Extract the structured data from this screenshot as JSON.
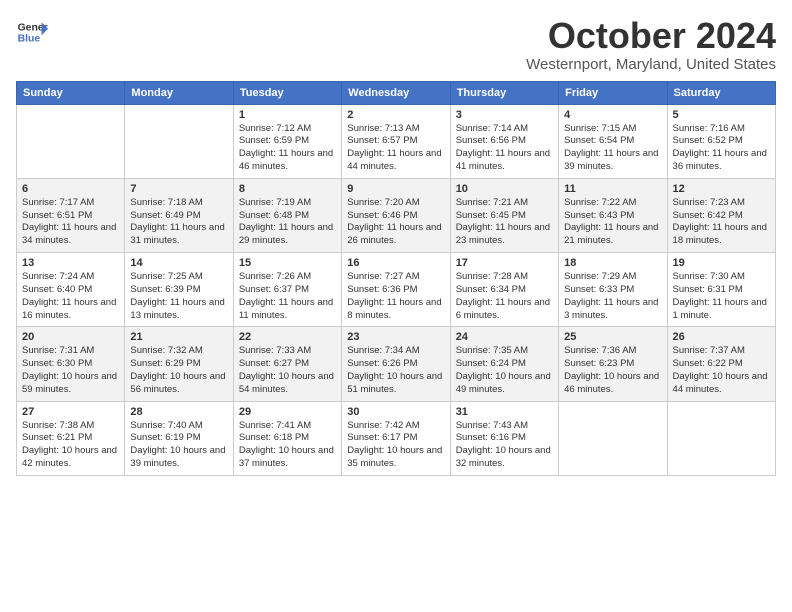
{
  "header": {
    "logo_line1": "General",
    "logo_line2": "Blue",
    "month": "October 2024",
    "location": "Westernport, Maryland, United States"
  },
  "days_of_week": [
    "Sunday",
    "Monday",
    "Tuesday",
    "Wednesday",
    "Thursday",
    "Friday",
    "Saturday"
  ],
  "weeks": [
    [
      {
        "day": "",
        "info": ""
      },
      {
        "day": "",
        "info": ""
      },
      {
        "day": "1",
        "info": "Sunrise: 7:12 AM\nSunset: 6:59 PM\nDaylight: 11 hours and 46 minutes."
      },
      {
        "day": "2",
        "info": "Sunrise: 7:13 AM\nSunset: 6:57 PM\nDaylight: 11 hours and 44 minutes."
      },
      {
        "day": "3",
        "info": "Sunrise: 7:14 AM\nSunset: 6:56 PM\nDaylight: 11 hours and 41 minutes."
      },
      {
        "day": "4",
        "info": "Sunrise: 7:15 AM\nSunset: 6:54 PM\nDaylight: 11 hours and 39 minutes."
      },
      {
        "day": "5",
        "info": "Sunrise: 7:16 AM\nSunset: 6:52 PM\nDaylight: 11 hours and 36 minutes."
      }
    ],
    [
      {
        "day": "6",
        "info": "Sunrise: 7:17 AM\nSunset: 6:51 PM\nDaylight: 11 hours and 34 minutes."
      },
      {
        "day": "7",
        "info": "Sunrise: 7:18 AM\nSunset: 6:49 PM\nDaylight: 11 hours and 31 minutes."
      },
      {
        "day": "8",
        "info": "Sunrise: 7:19 AM\nSunset: 6:48 PM\nDaylight: 11 hours and 29 minutes."
      },
      {
        "day": "9",
        "info": "Sunrise: 7:20 AM\nSunset: 6:46 PM\nDaylight: 11 hours and 26 minutes."
      },
      {
        "day": "10",
        "info": "Sunrise: 7:21 AM\nSunset: 6:45 PM\nDaylight: 11 hours and 23 minutes."
      },
      {
        "day": "11",
        "info": "Sunrise: 7:22 AM\nSunset: 6:43 PM\nDaylight: 11 hours and 21 minutes."
      },
      {
        "day": "12",
        "info": "Sunrise: 7:23 AM\nSunset: 6:42 PM\nDaylight: 11 hours and 18 minutes."
      }
    ],
    [
      {
        "day": "13",
        "info": "Sunrise: 7:24 AM\nSunset: 6:40 PM\nDaylight: 11 hours and 16 minutes."
      },
      {
        "day": "14",
        "info": "Sunrise: 7:25 AM\nSunset: 6:39 PM\nDaylight: 11 hours and 13 minutes."
      },
      {
        "day": "15",
        "info": "Sunrise: 7:26 AM\nSunset: 6:37 PM\nDaylight: 11 hours and 11 minutes."
      },
      {
        "day": "16",
        "info": "Sunrise: 7:27 AM\nSunset: 6:36 PM\nDaylight: 11 hours and 8 minutes."
      },
      {
        "day": "17",
        "info": "Sunrise: 7:28 AM\nSunset: 6:34 PM\nDaylight: 11 hours and 6 minutes."
      },
      {
        "day": "18",
        "info": "Sunrise: 7:29 AM\nSunset: 6:33 PM\nDaylight: 11 hours and 3 minutes."
      },
      {
        "day": "19",
        "info": "Sunrise: 7:30 AM\nSunset: 6:31 PM\nDaylight: 11 hours and 1 minute."
      }
    ],
    [
      {
        "day": "20",
        "info": "Sunrise: 7:31 AM\nSunset: 6:30 PM\nDaylight: 10 hours and 59 minutes."
      },
      {
        "day": "21",
        "info": "Sunrise: 7:32 AM\nSunset: 6:29 PM\nDaylight: 10 hours and 56 minutes."
      },
      {
        "day": "22",
        "info": "Sunrise: 7:33 AM\nSunset: 6:27 PM\nDaylight: 10 hours and 54 minutes."
      },
      {
        "day": "23",
        "info": "Sunrise: 7:34 AM\nSunset: 6:26 PM\nDaylight: 10 hours and 51 minutes."
      },
      {
        "day": "24",
        "info": "Sunrise: 7:35 AM\nSunset: 6:24 PM\nDaylight: 10 hours and 49 minutes."
      },
      {
        "day": "25",
        "info": "Sunrise: 7:36 AM\nSunset: 6:23 PM\nDaylight: 10 hours and 46 minutes."
      },
      {
        "day": "26",
        "info": "Sunrise: 7:37 AM\nSunset: 6:22 PM\nDaylight: 10 hours and 44 minutes."
      }
    ],
    [
      {
        "day": "27",
        "info": "Sunrise: 7:38 AM\nSunset: 6:21 PM\nDaylight: 10 hours and 42 minutes."
      },
      {
        "day": "28",
        "info": "Sunrise: 7:40 AM\nSunset: 6:19 PM\nDaylight: 10 hours and 39 minutes."
      },
      {
        "day": "29",
        "info": "Sunrise: 7:41 AM\nSunset: 6:18 PM\nDaylight: 10 hours and 37 minutes."
      },
      {
        "day": "30",
        "info": "Sunrise: 7:42 AM\nSunset: 6:17 PM\nDaylight: 10 hours and 35 minutes."
      },
      {
        "day": "31",
        "info": "Sunrise: 7:43 AM\nSunset: 6:16 PM\nDaylight: 10 hours and 32 minutes."
      },
      {
        "day": "",
        "info": ""
      },
      {
        "day": "",
        "info": ""
      }
    ]
  ]
}
